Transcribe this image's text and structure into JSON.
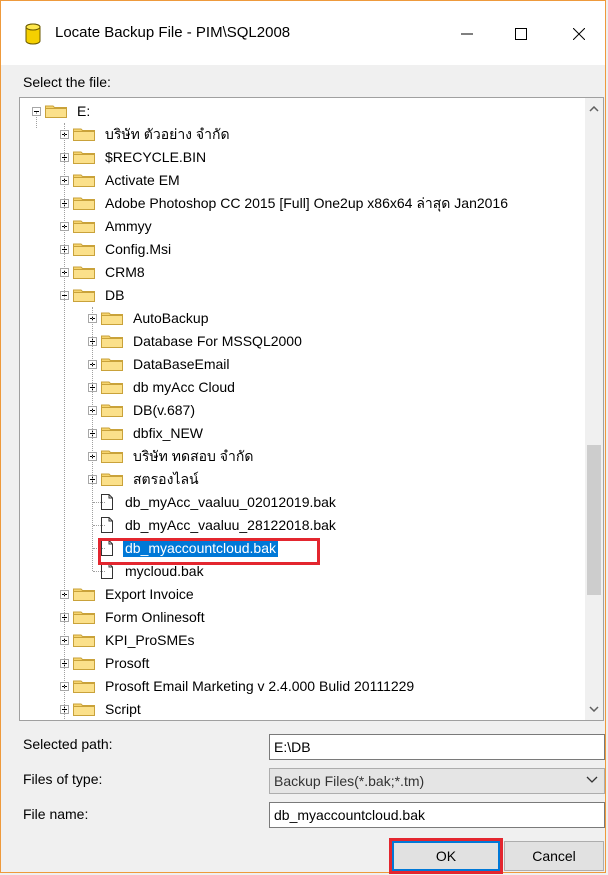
{
  "window": {
    "title": "Locate Backup File - PIM\\SQL2008",
    "minimize_icon": "minimize-icon",
    "maximize_icon": "maximize-icon",
    "close_icon": "close-icon"
  },
  "tree": {
    "label": "Select the file:",
    "root": "E:",
    "items": [
      "บริษัท ตัวอย่าง จำกัด",
      "$RECYCLE.BIN",
      "Activate EM",
      "Adobe Photoshop CC 2015 [Full] One2up x86x64 ล่าสุด Jan2016",
      "Ammyy",
      "Config.Msi",
      "CRM8",
      "DB"
    ],
    "db_children": [
      "AutoBackup",
      "Database For MSSQL2000",
      "DataBaseEmail",
      "db myAcc Cloud",
      "DB(v.687)",
      "dbfix_NEW",
      "บริษัท ทดสอบ จำกัด",
      "สตรองไลน์"
    ],
    "db_files": [
      "db_myAcc_vaaluu_02012019.bak",
      "db_myAcc_vaaluu_28122018.bak",
      "db_myaccountcloud.bak",
      "mycloud.bak"
    ],
    "after_items": [
      "Export Invoice",
      "Form Onlinesoft",
      "KPI_ProSMEs",
      "Prosoft",
      "Prosoft Email Marketing v 2.4.000 Bulid 20111229",
      "Script"
    ],
    "selected": "db_myaccountcloud.bak"
  },
  "fields": {
    "selected_path_label": "Selected path:",
    "selected_path_value": "E:\\DB",
    "files_of_type_label": "Files of type:",
    "files_of_type_value": "Backup Files(*.bak;*.tm)",
    "file_name_label": "File name:",
    "file_name_value": "db_myaccountcloud.bak"
  },
  "buttons": {
    "ok": "OK",
    "cancel": "Cancel"
  },
  "colors": {
    "selection": "#0078d7",
    "highlight": "#e3262f",
    "window_border": "#ee9a3c"
  }
}
